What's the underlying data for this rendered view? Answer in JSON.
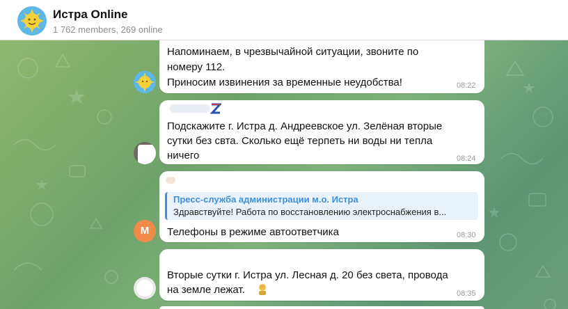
{
  "header": {
    "title": "Истра Online",
    "subtitle": "1 762 members, 269 online"
  },
  "messages": [
    {
      "lines": [
        "Напоминаем, в чрезвычайной ситуации, звоните по",
        "номеру 112.",
        "Приносим извинения за временные неудобства!"
      ],
      "time": "08:22"
    },
    {
      "lines": [
        "Подскажите г. Истра д. Андреевское ул. Зелёная вторые",
        "сутки без свта. Сколько ещё терпеть ни воды ни тепла",
        "ничего"
      ],
      "time": "08:24"
    },
    {
      "reply_title": "Пресс-служба администрации м.о. Истра",
      "reply_text": "Здравствуйте! Работа по восстановлению электроснабжения в...",
      "lines": [
        "Телефоны в режиме автоответчика"
      ],
      "time": "08:30",
      "avatar_letter": "M"
    },
    {
      "lines": [
        "Вторые сутки  г. Истра ул. Лесная д. 20 без света, провода",
        "на земле лежат. "
      ],
      "time": "08:35"
    }
  ],
  "icons": {
    "header_avatar": "sun-logo-icon",
    "emoji": "facepalm-emoji-icon"
  },
  "colors": {
    "accent": "#3d8fd8",
    "avatar_orange": "#f08a4b",
    "chat_green": "#7fae70"
  }
}
